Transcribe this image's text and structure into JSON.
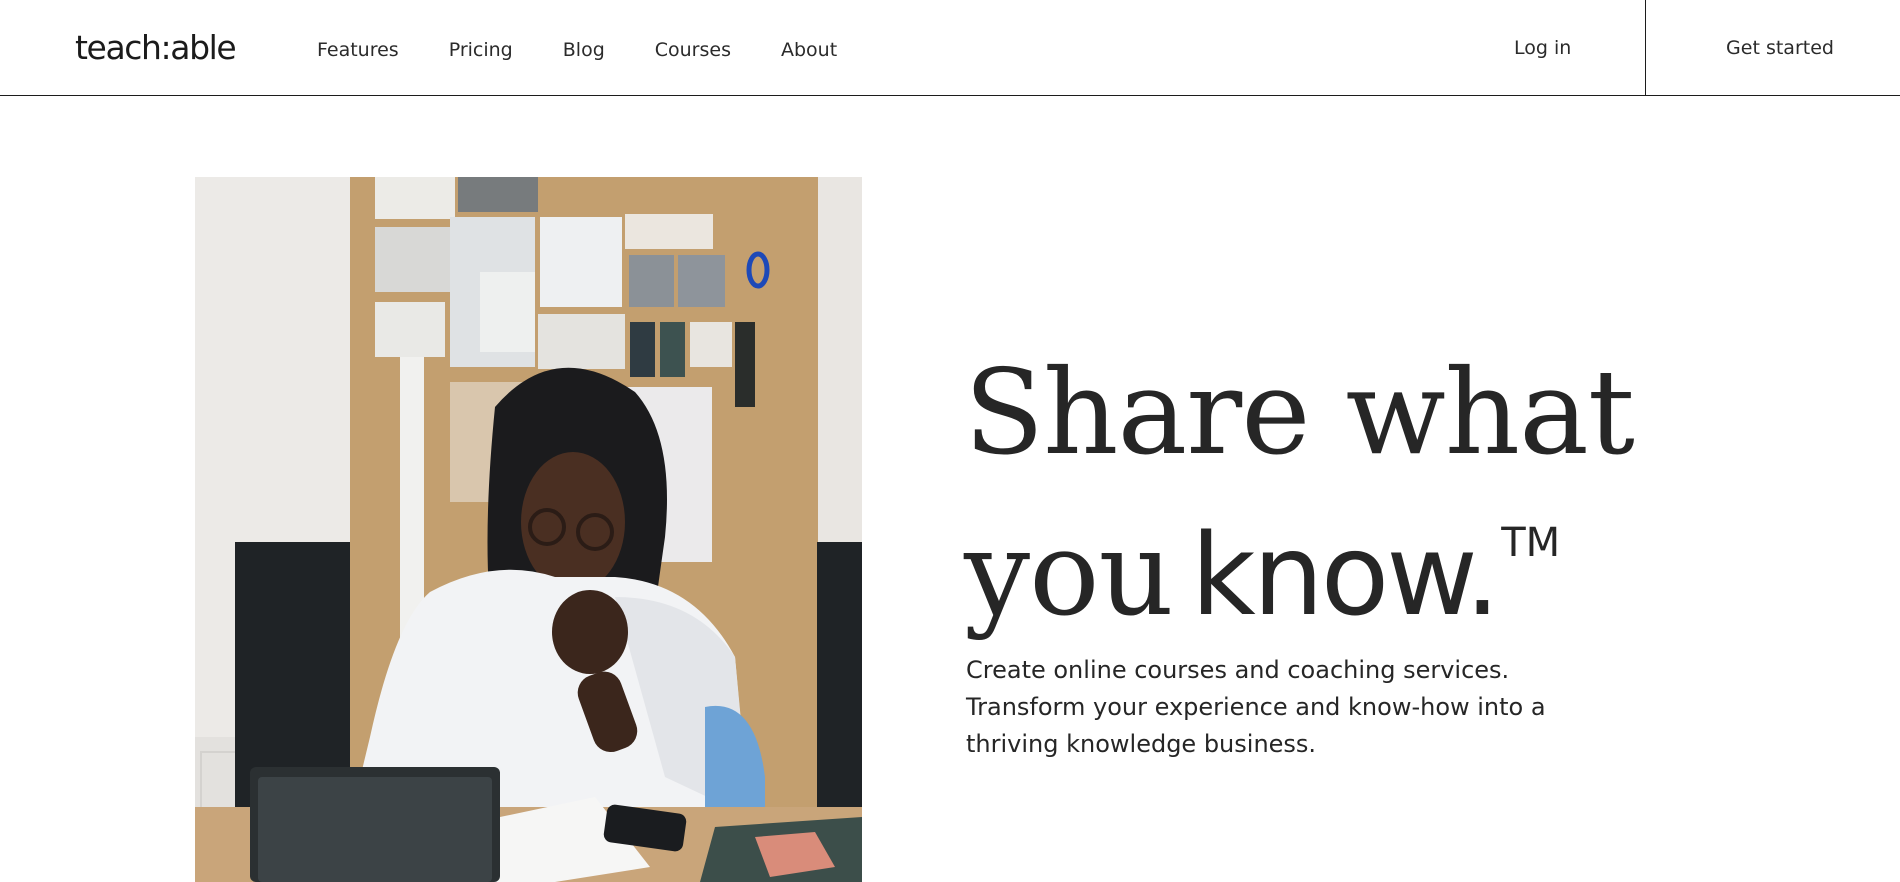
{
  "header": {
    "logo": "teach:able",
    "nav": [
      {
        "label": "Features"
      },
      {
        "label": "Pricing"
      },
      {
        "label": "Blog"
      },
      {
        "label": "Courses"
      },
      {
        "label": "About"
      }
    ],
    "login_label": "Log in",
    "cta_label": "Get started"
  },
  "hero": {
    "headline_line1": "Share what",
    "headline_line2_serif": "you",
    "headline_line2_sans": "know.",
    "trademark": "TM",
    "subtext_lines": [
      "Create online courses and coaching services.",
      "Transform your experience and know-how into a",
      "thriving knowledge business."
    ],
    "photo": "man-at-desk-with-tablet-photo"
  },
  "colors": {
    "text": "#262626",
    "border": "#1c1c1c",
    "background": "#ffffff"
  }
}
